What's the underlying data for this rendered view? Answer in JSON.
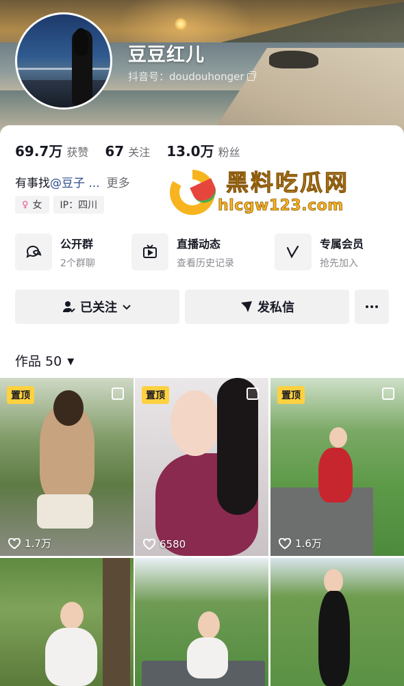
{
  "profile": {
    "nickname": "豆豆红儿",
    "douyin_id": "抖音号：doudouhonger"
  },
  "stats": [
    {
      "num": "69.7万",
      "label": "获赞"
    },
    {
      "num": "67",
      "label": "关注"
    },
    {
      "num": "13.0万",
      "label": "粉丝"
    }
  ],
  "bio": {
    "text": "有事找",
    "mention": "@豆子 ...",
    "more": "更多"
  },
  "tags": {
    "gender": "女",
    "ip": "IP：四川"
  },
  "watermark": {
    "title": "黑料吃瓜网",
    "url": "hlcgw123.com"
  },
  "features": [
    {
      "icon": "chat-group-icon",
      "title": "公开群",
      "sub": "2个群聊"
    },
    {
      "icon": "tv-live-icon",
      "title": "直播动态",
      "sub": "查看历史记录"
    },
    {
      "icon": "vip-v-icon",
      "title": "专属会员",
      "sub": "抢先加入"
    }
  ],
  "actions": {
    "followed": "已关注",
    "message": "发私信",
    "more_icon": "more-dots-icon"
  },
  "works": {
    "label": "作品 50"
  },
  "grid": [
    {
      "pinned": "置顶",
      "likes": "1.7万"
    },
    {
      "pinned": "置顶",
      "likes": "6580"
    },
    {
      "pinned": "置顶",
      "likes": "1.6万"
    },
    {
      "pinned": "",
      "likes": ""
    },
    {
      "pinned": "",
      "likes": ""
    },
    {
      "pinned": "",
      "likes": ""
    }
  ],
  "colors": {
    "pin_badge": "#fdd13f",
    "mention": "#2b4c8c",
    "watermark": "#f7b41e"
  }
}
